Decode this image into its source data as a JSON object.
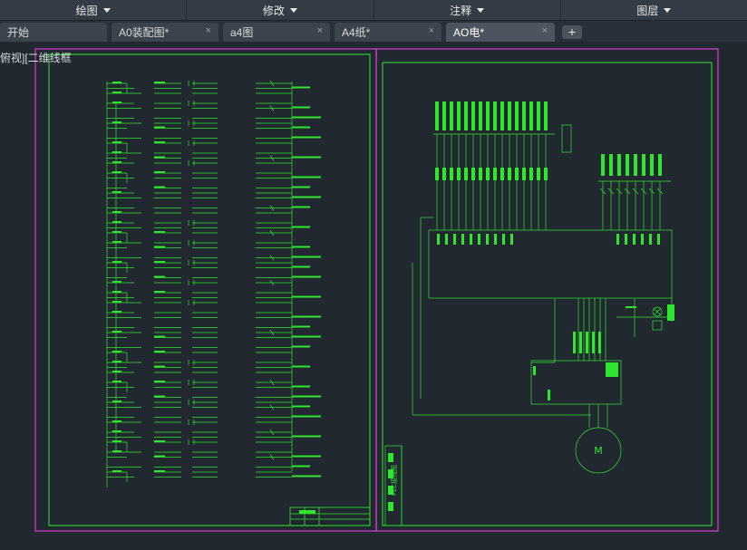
{
  "ribbon": {
    "tabs": [
      {
        "label": "绘图"
      },
      {
        "label": "修改"
      },
      {
        "label": "注释"
      },
      {
        "label": "图层"
      }
    ]
  },
  "file_tabs": [
    {
      "label": "开始",
      "closable": false
    },
    {
      "label": "A0装配图*",
      "closable": true
    },
    {
      "label": "a4图",
      "closable": true
    },
    {
      "label": "A4纸*",
      "closable": true
    },
    {
      "label": "AO电*",
      "closable": true,
      "active": true
    }
  ],
  "add_tab_label": "+",
  "close_glyph": "×",
  "viewport": {
    "view_label": "俯视][二维线框",
    "background": "#212830"
  },
  "drawing": {
    "sheet_border_color": "#c83cc8",
    "line_color": "#2ee62e",
    "right_sheet": {
      "motor_label": "M",
      "title_block_label": "PLC接线图"
    }
  }
}
